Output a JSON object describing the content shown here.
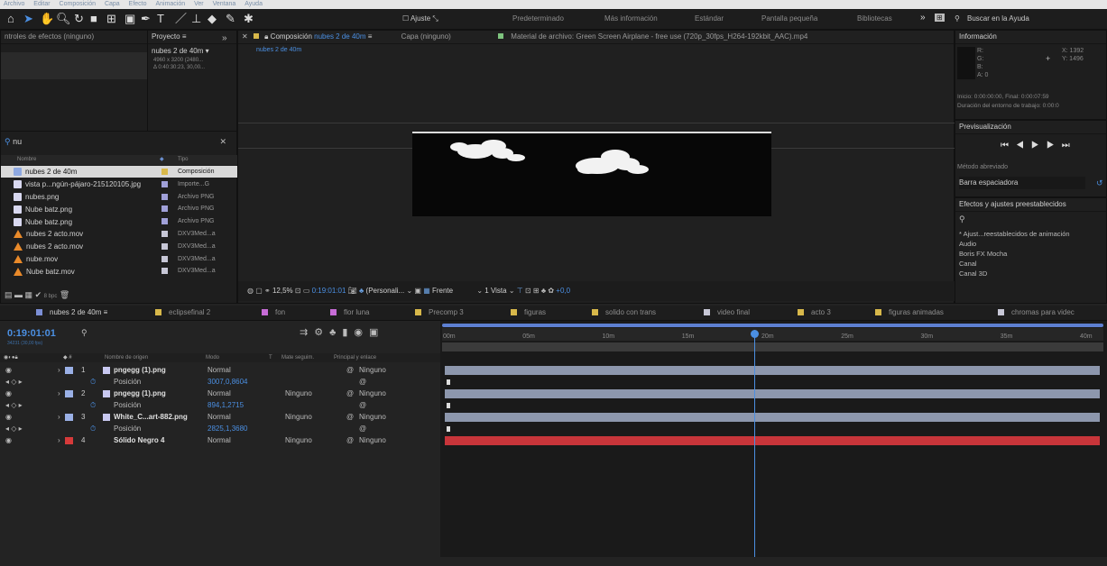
{
  "menubar": [
    "Archivo",
    "Editar",
    "Composición",
    "Capa",
    "Efecto",
    "Animación",
    "Ver",
    "Ventana",
    "Ayuda"
  ],
  "toolbar": {
    "ajuste_label": "Ajuste",
    "workspaces": [
      "Predeterminado",
      "Más información",
      "Estándar",
      "Pantalla pequeña",
      "Bibliotecas"
    ],
    "more": "»",
    "search_placeholder": "Buscar en la Ayuda"
  },
  "effects_panel": {
    "title": "ntroles de efectos (ninguno)"
  },
  "project_panel": {
    "title": "Proyecto",
    "comp_name": "nubes 2 de 40m ▾",
    "comp_info1": "4960 x 3200 (2480...",
    "comp_info2": "Δ 0:40:30:23, 30,00...",
    "search_value": "nu",
    "col_name": "Nombre",
    "col_type": "Tipo",
    "items": [
      {
        "name": "nubes 2 de 40m",
        "type": "Composición",
        "icon": "comp",
        "selected": true
      },
      {
        "name": "vista p...ngún-pájaro-215120105.jpg",
        "type": "Importe...G",
        "icon": "image"
      },
      {
        "name": "nubes.png",
        "type": "Archivo PNG",
        "icon": "image"
      },
      {
        "name": "Nube batz.png",
        "type": "Archivo PNG",
        "icon": "image"
      },
      {
        "name": "Nube batz.png",
        "type": "Archivo PNG",
        "icon": "image"
      },
      {
        "name": "nubes 2 acto.mov",
        "type": "DXV3Med...a",
        "icon": "video"
      },
      {
        "name": "nubes 2 acto.mov",
        "type": "DXV3Med...a",
        "icon": "video"
      },
      {
        "name": "nube.mov",
        "type": "DXV3Med...a",
        "icon": "video"
      },
      {
        "name": "Nube batz.mov",
        "type": "DXV3Med...a",
        "icon": "video"
      }
    ],
    "bpc": "8 bpc"
  },
  "composition": {
    "tab_label": "Composición",
    "comp_name": "nubes 2 de 40m",
    "breadcrumb": "nubes 2 de 40m",
    "layer_label": "Capa (ninguno)",
    "footage_label": "Material de archivo: Green Screen Airplane - free use (720p_30fps_H264-192kbit_AAC).mp4",
    "zoom": "12,5%",
    "timecode": "0:19:01:01",
    "view_mode": "(Personali...",
    "camera": "Frente",
    "views": "1 Vista",
    "offset": "+0,0"
  },
  "info_panel": {
    "title": "Información",
    "r": "R:",
    "g": "G:",
    "b": "B:",
    "a": "A: 0",
    "x": "X: 1392",
    "y": "Y: 1496",
    "start_end": "Inicio: 0:00:00:00, Final: 0:00:07:59",
    "duration": "Duración del entorno de trabajo: 0:00:0"
  },
  "preview_panel": {
    "title": "Previsualización",
    "method_label": "Método abreviado",
    "method_value": "Barra espaciadora"
  },
  "effects_presets": {
    "title": "Efectos y ajustes preestablecidos",
    "items": [
      "* Ajust...reestablecidos de animación",
      "Audio",
      "Boris FX Mocha",
      "Canal",
      "Canal 3D"
    ]
  },
  "timeline_tabs": [
    {
      "label": "nubes 2 de 40m",
      "color": "#7c8fd6",
      "active": true
    },
    {
      "label": "eclipsefinal 2",
      "color": "#d8b84a"
    },
    {
      "label": "fon",
      "color": "#c76cd6"
    },
    {
      "label": "flor luna",
      "color": "#c76cd6"
    },
    {
      "label": "Precomp 3",
      "color": "#d8b84a"
    },
    {
      "label": "figuras",
      "color": "#d8b84a"
    },
    {
      "label": "solido con trans",
      "color": "#d8b84a"
    },
    {
      "label": "video final",
      "color": "#c7c7d6"
    },
    {
      "label": "acto 3",
      "color": "#d8b84a"
    },
    {
      "label": "figuras animadas",
      "color": "#d8b84a"
    },
    {
      "label": "chromas para videc",
      "color": "#c7c7d6"
    }
  ],
  "timeline": {
    "timecode": "0:19:01:01",
    "sub_timecode": "34231 (30,00 fps)",
    "col_name": "Nombre de origen",
    "col_mode": "Modo",
    "col_t": "T",
    "col_matte": "Mate seguim.",
    "col_parent": "Principal y enlace",
    "ruler": [
      "00m",
      "05m",
      "10m",
      "15m",
      "20m",
      "25m",
      "30m",
      "35m",
      "40m"
    ],
    "layers": [
      {
        "num": "1",
        "name": "pngegg (1).png",
        "mode": "Normal",
        "matte": "",
        "parent": "Ninguno",
        "color": "#9ab0e6",
        "prop": "Posición",
        "prop_val": "3007,0,8604"
      },
      {
        "num": "2",
        "name": "pngegg (1).png",
        "mode": "Normal",
        "matte": "Ninguno",
        "parent": "Ninguno",
        "color": "#9ab0e6",
        "prop": "Posición",
        "prop_val": "894,1,2715"
      },
      {
        "num": "3",
        "name": "White_C...art-882.png",
        "mode": "Normal",
        "matte": "Ninguno",
        "parent": "Ninguno",
        "color": "#9ab0e6",
        "prop": "Posición",
        "prop_val": "2825,1,3680"
      },
      {
        "num": "4",
        "name": "Sólido Negro 4",
        "mode": "Normal",
        "matte": "Ninguno",
        "parent": "Ninguno",
        "color": "#d63a3a"
      }
    ],
    "playhead_fraction": 0.475
  }
}
